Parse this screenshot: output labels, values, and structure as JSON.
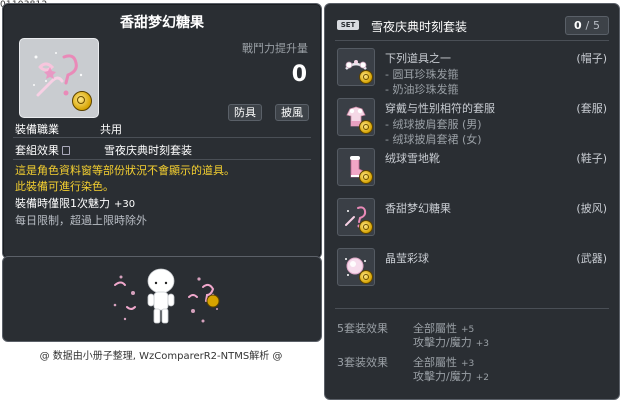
{
  "item_id": "01103812",
  "item": {
    "title": "香甜梦幻糖果",
    "power_label": "戰鬥力提升量",
    "power_value": "0",
    "tags": [
      "防具",
      "披風"
    ],
    "job_label": "裝備職業",
    "job_value": "共用",
    "set_label": "套組效果",
    "set_value": "雪夜庆典时刻套装",
    "desc_line1": "這是角色資料窗等部份狀況不會顯示的道具。",
    "desc_line2": "此裝備可進行染色。",
    "equip_bonus_label": "裝備時僅限1次魅力",
    "equip_bonus_value": "+30",
    "limit_text": "每日限制，超過上限時除外"
  },
  "credit": "@ 数据由小册子整理, WzComparerR2-NTMS解析 @",
  "set": {
    "badge": "SET",
    "name": "雪夜庆典时刻套装",
    "count_current": "0",
    "count_sep": "/",
    "count_total": "5",
    "items": [
      {
        "icon": "hairpin-icon",
        "name": "下列道具之一",
        "slot": "(帽子)",
        "subs": [
          "- 圆耳珍珠发箍",
          "- 奶油珍珠发箍"
        ]
      },
      {
        "icon": "outfit-icon",
        "name": "穿戴与性别相符的套服",
        "slot": "(套服)",
        "subs": [
          "- 绒球披肩套服 (男)",
          "- 绒球披肩套裙 (女)"
        ]
      },
      {
        "icon": "boots-icon",
        "name": "绒球雪地靴",
        "slot": "(鞋子)",
        "subs": []
      },
      {
        "icon": "candy-icon",
        "name": "香甜梦幻糖果",
        "slot": "(披风)",
        "subs": []
      },
      {
        "icon": "orb-icon",
        "name": "晶莹彩球",
        "slot": "(武器)",
        "subs": []
      }
    ],
    "bonuses": [
      {
        "label": "5套装效果",
        "stats": [
          {
            "name": "全部屬性",
            "value": "+5"
          },
          {
            "name": "攻擊力/魔力",
            "value": "+3"
          }
        ]
      },
      {
        "label": "3套装效果",
        "stats": [
          {
            "name": "全部屬性",
            "value": "+3"
          },
          {
            "name": "攻擊力/魔力",
            "value": "+2"
          }
        ]
      }
    ]
  }
}
